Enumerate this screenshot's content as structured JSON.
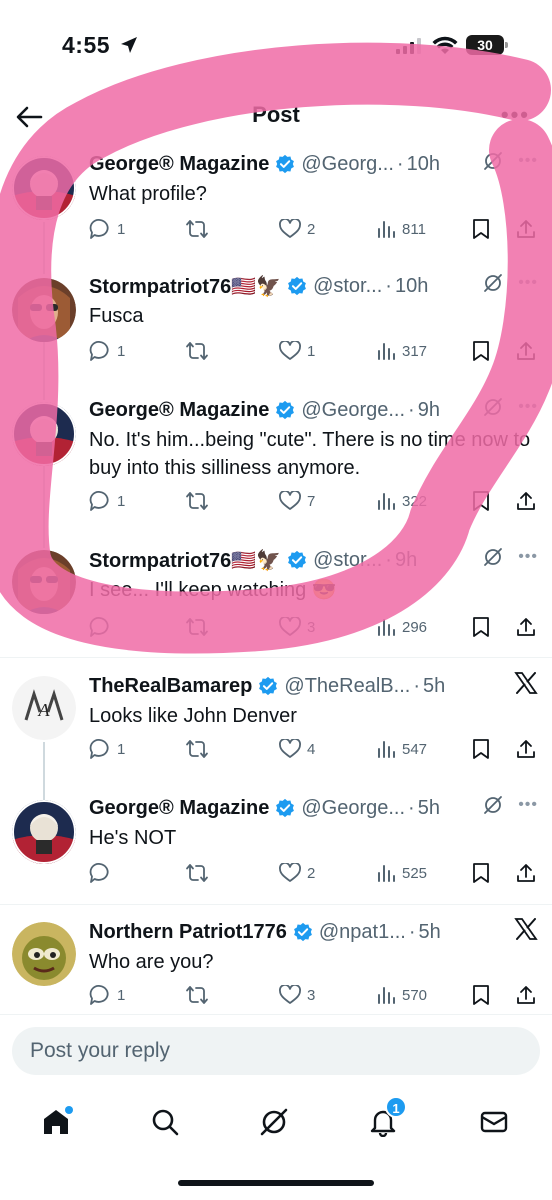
{
  "status_bar": {
    "time": "4:55",
    "battery": "30"
  },
  "header": {
    "title": "Post"
  },
  "posts": [
    {
      "name": "George® Magazine",
      "handle": "@Georg...",
      "time": "10h",
      "text": "What profile?",
      "replies": "1",
      "reposts": "",
      "likes": "2",
      "views": "811",
      "right_icon": "grok-icon"
    },
    {
      "name": "Stormpatriot76🇺🇸🦅",
      "handle": "@stor...",
      "time": "10h",
      "text": "Fusca",
      "replies": "1",
      "reposts": "",
      "likes": "1",
      "views": "317",
      "right_icon": "grok-icon"
    },
    {
      "name": "George® Magazine",
      "handle": "@George...",
      "time": "9h",
      "text": "No. It's him...being \"cute\". There is no time now to buy into this silliness anymore.",
      "replies": "1",
      "reposts": "",
      "likes": "7",
      "views": "322",
      "right_icon": "grok-icon"
    },
    {
      "name": "Stormpatriot76🇺🇸🦅",
      "handle": "@stor...",
      "time": "9h",
      "text": "I see... I'll keep watching 😎",
      "replies": "",
      "reposts": "",
      "likes": "3",
      "views": "296",
      "right_icon": "grok-icon"
    },
    {
      "name": "TheRealBamarep",
      "handle": "@TheRealB...",
      "time": "5h",
      "text": "Looks like John Denver",
      "replies": "1",
      "reposts": "",
      "likes": "4",
      "views": "547",
      "right_icon": "x-icon"
    },
    {
      "name": "George® Magazine",
      "handle": "@George...",
      "time": "5h",
      "text": "He's NOT",
      "replies": "",
      "reposts": "",
      "likes": "2",
      "views": "525",
      "right_icon": "grok-icon"
    },
    {
      "name": "Northern Patriot1776",
      "handle": "@npat1...",
      "time": "5h",
      "text": "Who are you?",
      "replies": "1",
      "reposts": "",
      "likes": "3",
      "views": "570",
      "right_icon": "x-icon"
    }
  ],
  "reply": {
    "placeholder": "Post your reply"
  },
  "tabs": {
    "notifications_badge": "1"
  },
  "colors": {
    "accent": "#1d9bf0",
    "highlight": "#f06ba6",
    "muted": "#536471"
  }
}
